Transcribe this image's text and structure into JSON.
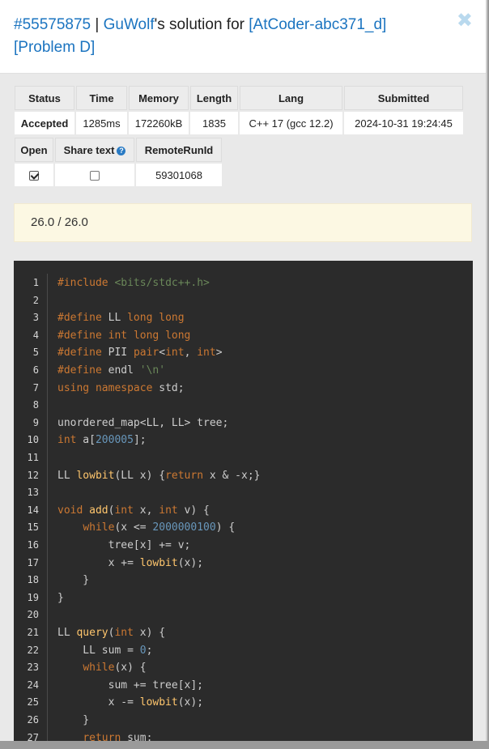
{
  "header": {
    "submission_id": "#55575875",
    "separator": "|",
    "user": "GuWolf",
    "suffix": "'s solution for",
    "problem": "[AtCoder-abc371_d] [Problem D]",
    "close": "✖"
  },
  "info_table": {
    "headers": [
      "Status",
      "Time",
      "Memory",
      "Length",
      "Lang",
      "Submitted"
    ],
    "values": [
      "Accepted",
      "1285ms",
      "172260kB",
      "1835",
      "C++ 17 (gcc 12.2)",
      "2024-10-31 19:24:45"
    ]
  },
  "meta_table": {
    "headers": [
      "Open",
      "Share text",
      "RemoteRunId"
    ],
    "help_icon": "?",
    "open_checked": true,
    "share_checked": false,
    "remote_run_id": "59301068"
  },
  "score": "26.0 / 26.0",
  "code": {
    "lines": [
      "#include <bits/stdc++.h>",
      "",
      "#define LL long long",
      "#define int long long",
      "#define PII pair<int, int>",
      "#define endl '\\n'",
      "using namespace std;",
      "",
      "unordered_map<LL, LL> tree;",
      "int a[200005];",
      "",
      "LL lowbit(LL x) {return x & -x;}",
      "",
      "void add(int x, int v) {",
      "    while(x <= 2000000100) {",
      "        tree[x] += v;",
      "        x += lowbit(x);",
      "    }",
      "}",
      "",
      "LL query(int x) {",
      "    LL sum = 0;",
      "    while(x) {",
      "        sum += tree[x];",
      "        x -= lowbit(x);",
      "    }",
      "    return sum;"
    ]
  }
}
